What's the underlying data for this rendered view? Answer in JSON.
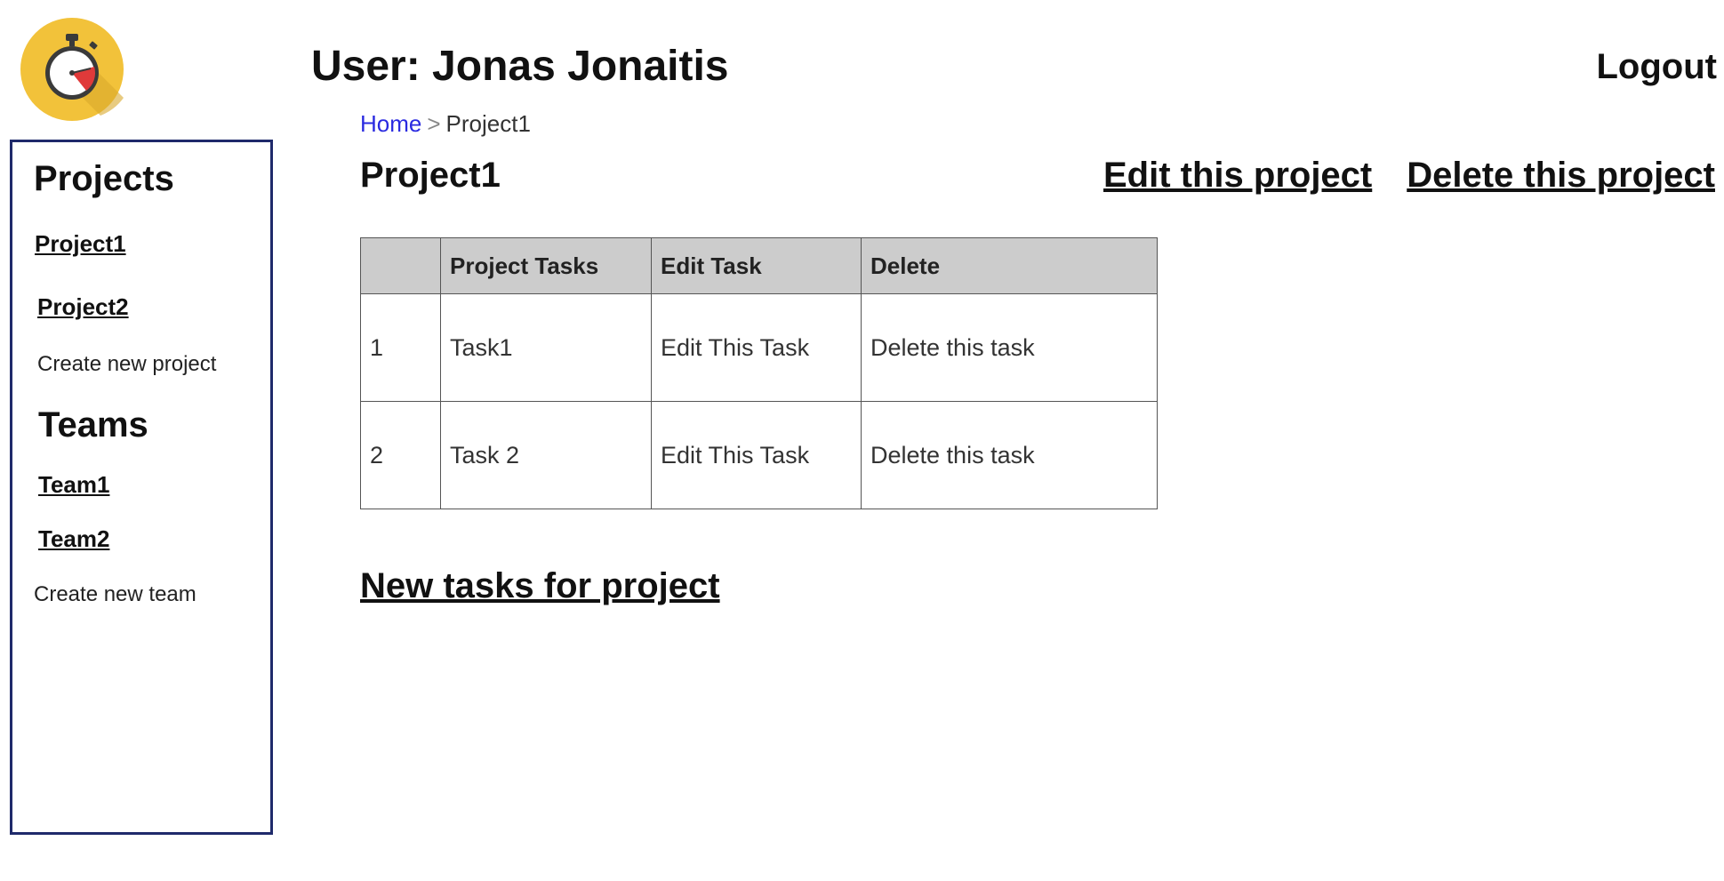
{
  "header": {
    "user_title": "User: Jonas Jonaitis",
    "logout_label": "Logout",
    "logo_icon": "stopwatch-icon"
  },
  "breadcrumb": {
    "home": "Home",
    "separator": ">",
    "current": "Project1"
  },
  "sidebar": {
    "projects_heading": "Projects",
    "projects": [
      {
        "label": "Project1"
      },
      {
        "label": "Project2"
      }
    ],
    "create_project": "Create new project",
    "teams_heading": "Teams",
    "teams": [
      {
        "label": "Team1"
      },
      {
        "label": "Team2"
      }
    ],
    "create_team": "Create new team"
  },
  "main": {
    "project_title": "Project1",
    "edit_project": "Edit this project",
    "delete_project": "Delete this project",
    "table": {
      "headers": [
        "",
        "Project Tasks",
        "Edit Task",
        "Delete"
      ],
      "rows": [
        {
          "num": "1",
          "task": "Task1",
          "edit": "Edit This Task",
          "delete": "Delete this task"
        },
        {
          "num": "2",
          "task": "Task 2",
          "edit": "Edit This Task",
          "delete": "Delete this task"
        }
      ]
    },
    "new_task": "New tasks for project"
  },
  "colors": {
    "sidebar_border": "#1f2a6b",
    "table_header_bg": "#cccccc",
    "breadcrumb_link": "#2a2ae0",
    "logo_bg": "#f2c23a",
    "logo_hand": "#e03a3a"
  }
}
